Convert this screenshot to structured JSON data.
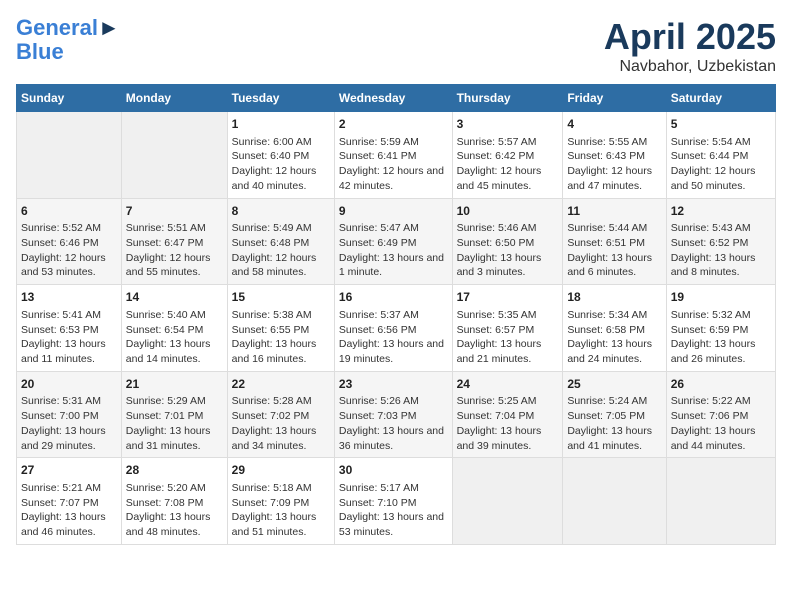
{
  "header": {
    "logo_line1": "General",
    "logo_line2": "Blue",
    "title": "April 2025",
    "subtitle": "Navbahor, Uzbekistan"
  },
  "calendar": {
    "days_of_week": [
      "Sunday",
      "Monday",
      "Tuesday",
      "Wednesday",
      "Thursday",
      "Friday",
      "Saturday"
    ],
    "weeks": [
      [
        {
          "day": "",
          "sunrise": "",
          "sunset": "",
          "daylight": ""
        },
        {
          "day": "",
          "sunrise": "",
          "sunset": "",
          "daylight": ""
        },
        {
          "day": "1",
          "sunrise": "Sunrise: 6:00 AM",
          "sunset": "Sunset: 6:40 PM",
          "daylight": "Daylight: 12 hours and 40 minutes."
        },
        {
          "day": "2",
          "sunrise": "Sunrise: 5:59 AM",
          "sunset": "Sunset: 6:41 PM",
          "daylight": "Daylight: 12 hours and 42 minutes."
        },
        {
          "day": "3",
          "sunrise": "Sunrise: 5:57 AM",
          "sunset": "Sunset: 6:42 PM",
          "daylight": "Daylight: 12 hours and 45 minutes."
        },
        {
          "day": "4",
          "sunrise": "Sunrise: 5:55 AM",
          "sunset": "Sunset: 6:43 PM",
          "daylight": "Daylight: 12 hours and 47 minutes."
        },
        {
          "day": "5",
          "sunrise": "Sunrise: 5:54 AM",
          "sunset": "Sunset: 6:44 PM",
          "daylight": "Daylight: 12 hours and 50 minutes."
        }
      ],
      [
        {
          "day": "6",
          "sunrise": "Sunrise: 5:52 AM",
          "sunset": "Sunset: 6:46 PM",
          "daylight": "Daylight: 12 hours and 53 minutes."
        },
        {
          "day": "7",
          "sunrise": "Sunrise: 5:51 AM",
          "sunset": "Sunset: 6:47 PM",
          "daylight": "Daylight: 12 hours and 55 minutes."
        },
        {
          "day": "8",
          "sunrise": "Sunrise: 5:49 AM",
          "sunset": "Sunset: 6:48 PM",
          "daylight": "Daylight: 12 hours and 58 minutes."
        },
        {
          "day": "9",
          "sunrise": "Sunrise: 5:47 AM",
          "sunset": "Sunset: 6:49 PM",
          "daylight": "Daylight: 13 hours and 1 minute."
        },
        {
          "day": "10",
          "sunrise": "Sunrise: 5:46 AM",
          "sunset": "Sunset: 6:50 PM",
          "daylight": "Daylight: 13 hours and 3 minutes."
        },
        {
          "day": "11",
          "sunrise": "Sunrise: 5:44 AM",
          "sunset": "Sunset: 6:51 PM",
          "daylight": "Daylight: 13 hours and 6 minutes."
        },
        {
          "day": "12",
          "sunrise": "Sunrise: 5:43 AM",
          "sunset": "Sunset: 6:52 PM",
          "daylight": "Daylight: 13 hours and 8 minutes."
        }
      ],
      [
        {
          "day": "13",
          "sunrise": "Sunrise: 5:41 AM",
          "sunset": "Sunset: 6:53 PM",
          "daylight": "Daylight: 13 hours and 11 minutes."
        },
        {
          "day": "14",
          "sunrise": "Sunrise: 5:40 AM",
          "sunset": "Sunset: 6:54 PM",
          "daylight": "Daylight: 13 hours and 14 minutes."
        },
        {
          "day": "15",
          "sunrise": "Sunrise: 5:38 AM",
          "sunset": "Sunset: 6:55 PM",
          "daylight": "Daylight: 13 hours and 16 minutes."
        },
        {
          "day": "16",
          "sunrise": "Sunrise: 5:37 AM",
          "sunset": "Sunset: 6:56 PM",
          "daylight": "Daylight: 13 hours and 19 minutes."
        },
        {
          "day": "17",
          "sunrise": "Sunrise: 5:35 AM",
          "sunset": "Sunset: 6:57 PM",
          "daylight": "Daylight: 13 hours and 21 minutes."
        },
        {
          "day": "18",
          "sunrise": "Sunrise: 5:34 AM",
          "sunset": "Sunset: 6:58 PM",
          "daylight": "Daylight: 13 hours and 24 minutes."
        },
        {
          "day": "19",
          "sunrise": "Sunrise: 5:32 AM",
          "sunset": "Sunset: 6:59 PM",
          "daylight": "Daylight: 13 hours and 26 minutes."
        }
      ],
      [
        {
          "day": "20",
          "sunrise": "Sunrise: 5:31 AM",
          "sunset": "Sunset: 7:00 PM",
          "daylight": "Daylight: 13 hours and 29 minutes."
        },
        {
          "day": "21",
          "sunrise": "Sunrise: 5:29 AM",
          "sunset": "Sunset: 7:01 PM",
          "daylight": "Daylight: 13 hours and 31 minutes."
        },
        {
          "day": "22",
          "sunrise": "Sunrise: 5:28 AM",
          "sunset": "Sunset: 7:02 PM",
          "daylight": "Daylight: 13 hours and 34 minutes."
        },
        {
          "day": "23",
          "sunrise": "Sunrise: 5:26 AM",
          "sunset": "Sunset: 7:03 PM",
          "daylight": "Daylight: 13 hours and 36 minutes."
        },
        {
          "day": "24",
          "sunrise": "Sunrise: 5:25 AM",
          "sunset": "Sunset: 7:04 PM",
          "daylight": "Daylight: 13 hours and 39 minutes."
        },
        {
          "day": "25",
          "sunrise": "Sunrise: 5:24 AM",
          "sunset": "Sunset: 7:05 PM",
          "daylight": "Daylight: 13 hours and 41 minutes."
        },
        {
          "day": "26",
          "sunrise": "Sunrise: 5:22 AM",
          "sunset": "Sunset: 7:06 PM",
          "daylight": "Daylight: 13 hours and 44 minutes."
        }
      ],
      [
        {
          "day": "27",
          "sunrise": "Sunrise: 5:21 AM",
          "sunset": "Sunset: 7:07 PM",
          "daylight": "Daylight: 13 hours and 46 minutes."
        },
        {
          "day": "28",
          "sunrise": "Sunrise: 5:20 AM",
          "sunset": "Sunset: 7:08 PM",
          "daylight": "Daylight: 13 hours and 48 minutes."
        },
        {
          "day": "29",
          "sunrise": "Sunrise: 5:18 AM",
          "sunset": "Sunset: 7:09 PM",
          "daylight": "Daylight: 13 hours and 51 minutes."
        },
        {
          "day": "30",
          "sunrise": "Sunrise: 5:17 AM",
          "sunset": "Sunset: 7:10 PM",
          "daylight": "Daylight: 13 hours and 53 minutes."
        },
        {
          "day": "",
          "sunrise": "",
          "sunset": "",
          "daylight": ""
        },
        {
          "day": "",
          "sunrise": "",
          "sunset": "",
          "daylight": ""
        },
        {
          "day": "",
          "sunrise": "",
          "sunset": "",
          "daylight": ""
        }
      ]
    ]
  }
}
